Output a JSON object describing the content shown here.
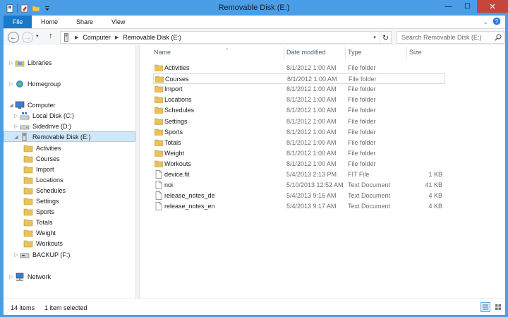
{
  "window": {
    "title": "Removable Disk (E:)",
    "minimize_glyph": "—",
    "maximize_glyph": "☐",
    "close_glyph": "✕"
  },
  "ribbon": {
    "file_tab": "File",
    "tabs": [
      "Home",
      "Share",
      "View"
    ],
    "expand_glyph": "⌄",
    "help_glyph": "?"
  },
  "nav": {
    "back_glyph": "←",
    "forward_glyph": "→",
    "dropdown_glyph": "▾",
    "up_glyph": "↑"
  },
  "address": {
    "crumbs": [
      "Computer",
      "Removable Disk (E:)"
    ],
    "separator_glyph": "▶",
    "dropdown_glyph": "▾",
    "refresh_glyph": "↻"
  },
  "search": {
    "placeholder": "Search Removable Disk (E:)"
  },
  "tree": {
    "expand_glyph": "▷",
    "collapse_glyph": "◢",
    "libraries": "Libraries",
    "homegroup": "Homegroup",
    "computer": "Computer",
    "local_disk": "Local Disk (C:)",
    "sidedrive": "Sidedrive (D:)",
    "removable": "Removable Disk (E:)",
    "subfolders": [
      "Activities",
      "Courses",
      "Import",
      "Locations",
      "Schedules",
      "Settings",
      "Sports",
      "Totals",
      "Weight",
      "Workouts"
    ],
    "backup": "BACKUP (F:)",
    "network": "Network"
  },
  "columns": {
    "name": "Name",
    "date": "Date modified",
    "type": "Type",
    "size": "Size",
    "sort_glyph": "^"
  },
  "files": [
    {
      "name": "Activities",
      "date": "8/1/2012 1:00 AM",
      "type": "File folder",
      "size": "",
      "icon": "folder"
    },
    {
      "name": "Courses",
      "date": "8/1/2012 1:00 AM",
      "type": "File folder",
      "size": "",
      "icon": "folder"
    },
    {
      "name": "Import",
      "date": "8/1/2012 1:00 AM",
      "type": "File folder",
      "size": "",
      "icon": "folder"
    },
    {
      "name": "Locations",
      "date": "8/1/2012 1:00 AM",
      "type": "File folder",
      "size": "",
      "icon": "folder"
    },
    {
      "name": "Schedules",
      "date": "8/1/2012 1:00 AM",
      "type": "File folder",
      "size": "",
      "icon": "folder"
    },
    {
      "name": "Settings",
      "date": "8/1/2012 1:00 AM",
      "type": "File folder",
      "size": "",
      "icon": "folder"
    },
    {
      "name": "Sports",
      "date": "8/1/2012 1:00 AM",
      "type": "File folder",
      "size": "",
      "icon": "folder"
    },
    {
      "name": "Totals",
      "date": "8/1/2012 1:00 AM",
      "type": "File folder",
      "size": "",
      "icon": "folder"
    },
    {
      "name": "Weight",
      "date": "8/1/2012 1:00 AM",
      "type": "File folder",
      "size": "",
      "icon": "folder"
    },
    {
      "name": "Workouts",
      "date": "8/1/2012 1:00 AM",
      "type": "File folder",
      "size": "",
      "icon": "folder"
    },
    {
      "name": "device.fit",
      "date": "5/4/2013 2:13 PM",
      "type": "FIT File",
      "size": "1 KB",
      "icon": "file"
    },
    {
      "name": "noi",
      "date": "5/10/2013 12:52 AM",
      "type": "Text Document",
      "size": "41 KB",
      "icon": "file"
    },
    {
      "name": "release_notes_de",
      "date": "5/4/2013 9:16 AM",
      "type": "Text Document",
      "size": "4 KB",
      "icon": "file"
    },
    {
      "name": "release_notes_en",
      "date": "5/4/2013 9:17 AM",
      "type": "Text Document",
      "size": "4 KB",
      "icon": "file"
    }
  ],
  "status": {
    "count": "14 items",
    "selected": "1 item selected"
  },
  "colors": {
    "titlebar": "#4a9ee8",
    "file_tab": "#1979ca",
    "close_button": "#c7463c",
    "selection": "#cce8ff",
    "folder": "#e8c35a"
  }
}
